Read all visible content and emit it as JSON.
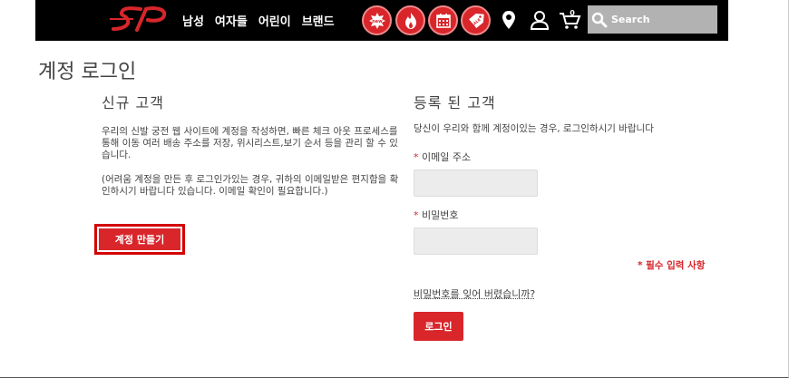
{
  "header": {
    "logo_text": "SP",
    "nav": [
      "남성",
      "여자들",
      "어린이",
      "브랜드"
    ],
    "icons": [
      "new-badge-icon",
      "fire-icon",
      "calendar-icon",
      "sale-tag-icon",
      "location-pin-icon",
      "user-icon",
      "cart-icon",
      "search-icon"
    ],
    "cart_count": "0",
    "search_placeholder": "Search"
  },
  "page": {
    "title": "계정 로그인"
  },
  "new_customer": {
    "title": "신규 고객",
    "paragraph1": "우리의 신발 궁전 웹 사이트에 계정을 작성하면, 빠른 체크 아웃 프로세스를 통해 이동 여러 배송 주소를 저장, 위시리스트,보기 순서 등을 관리 할 수 있습니다.",
    "paragraph2": "(어려움 계정을 만든 후 로그인가있는 경우, 귀하의 이메일받은 편지함을 확인하시기 바랍니다 있습니다. 이메일 확인이 필요합니다.)",
    "create_button": "계정 만들기"
  },
  "registered_customer": {
    "title": "등록 된 고객",
    "intro": "당신이 우리와 함께 계정이있는 경우, 로그인하시기 바랍니다",
    "email_label": "이메일 주소",
    "password_label": "비밀번호",
    "required_marker": "*",
    "required_note": "* 필수 입력 사항",
    "forgot_link": "비밀번호를 잊어 버렸습니까?",
    "login_button": "로그인"
  },
  "colors": {
    "brand_red": "#d8262b",
    "header_bg": "#000000",
    "input_bg": "#ececec"
  }
}
